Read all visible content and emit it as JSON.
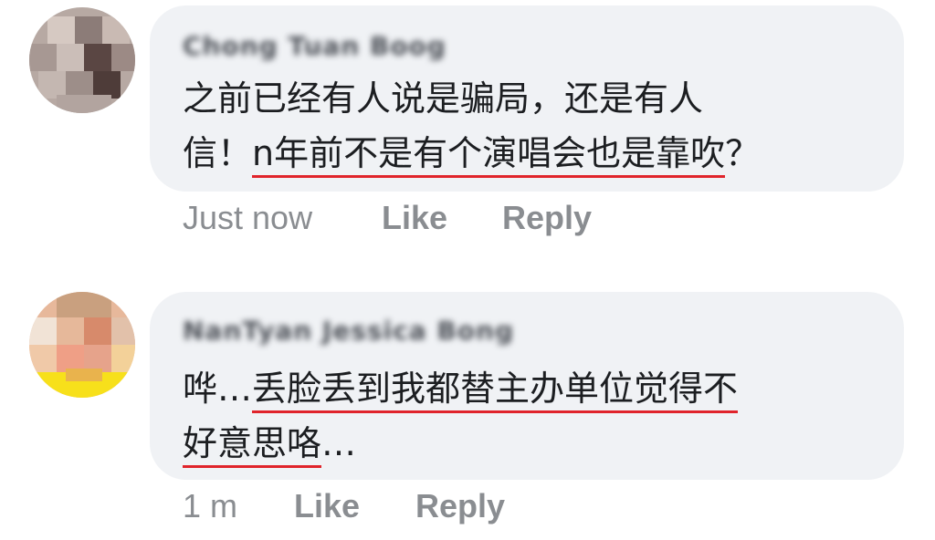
{
  "comments": [
    {
      "author": "Chong Tuan Boog",
      "text_line1": "之前已经有人说是骗局，还是有人",
      "text_line2_plain": "信！",
      "text_line2_underlined": "n年前不是有个演唱会也是靠吹",
      "text_line2_tail": "？",
      "time": "Just now",
      "like_label": "Like",
      "reply_label": "Reply"
    },
    {
      "author": "NanTyan Jessica Bong",
      "text_line1_plain": "哗…",
      "text_line1_underlined": "丢脸丢到我都替主办单位觉得不",
      "text_line2_underlined": "好意思咯",
      "text_line2_tail": "…",
      "time": "1 m",
      "like_label": "Like",
      "reply_label": "Reply"
    }
  ],
  "colors": {
    "bubble_bg": "#f0f2f5",
    "underline": "#e0242b",
    "meta_text": "#8a8d91",
    "body_text": "#1c1e21"
  },
  "icons": [
    "avatar-pixelated-1",
    "avatar-pixelated-2"
  ]
}
